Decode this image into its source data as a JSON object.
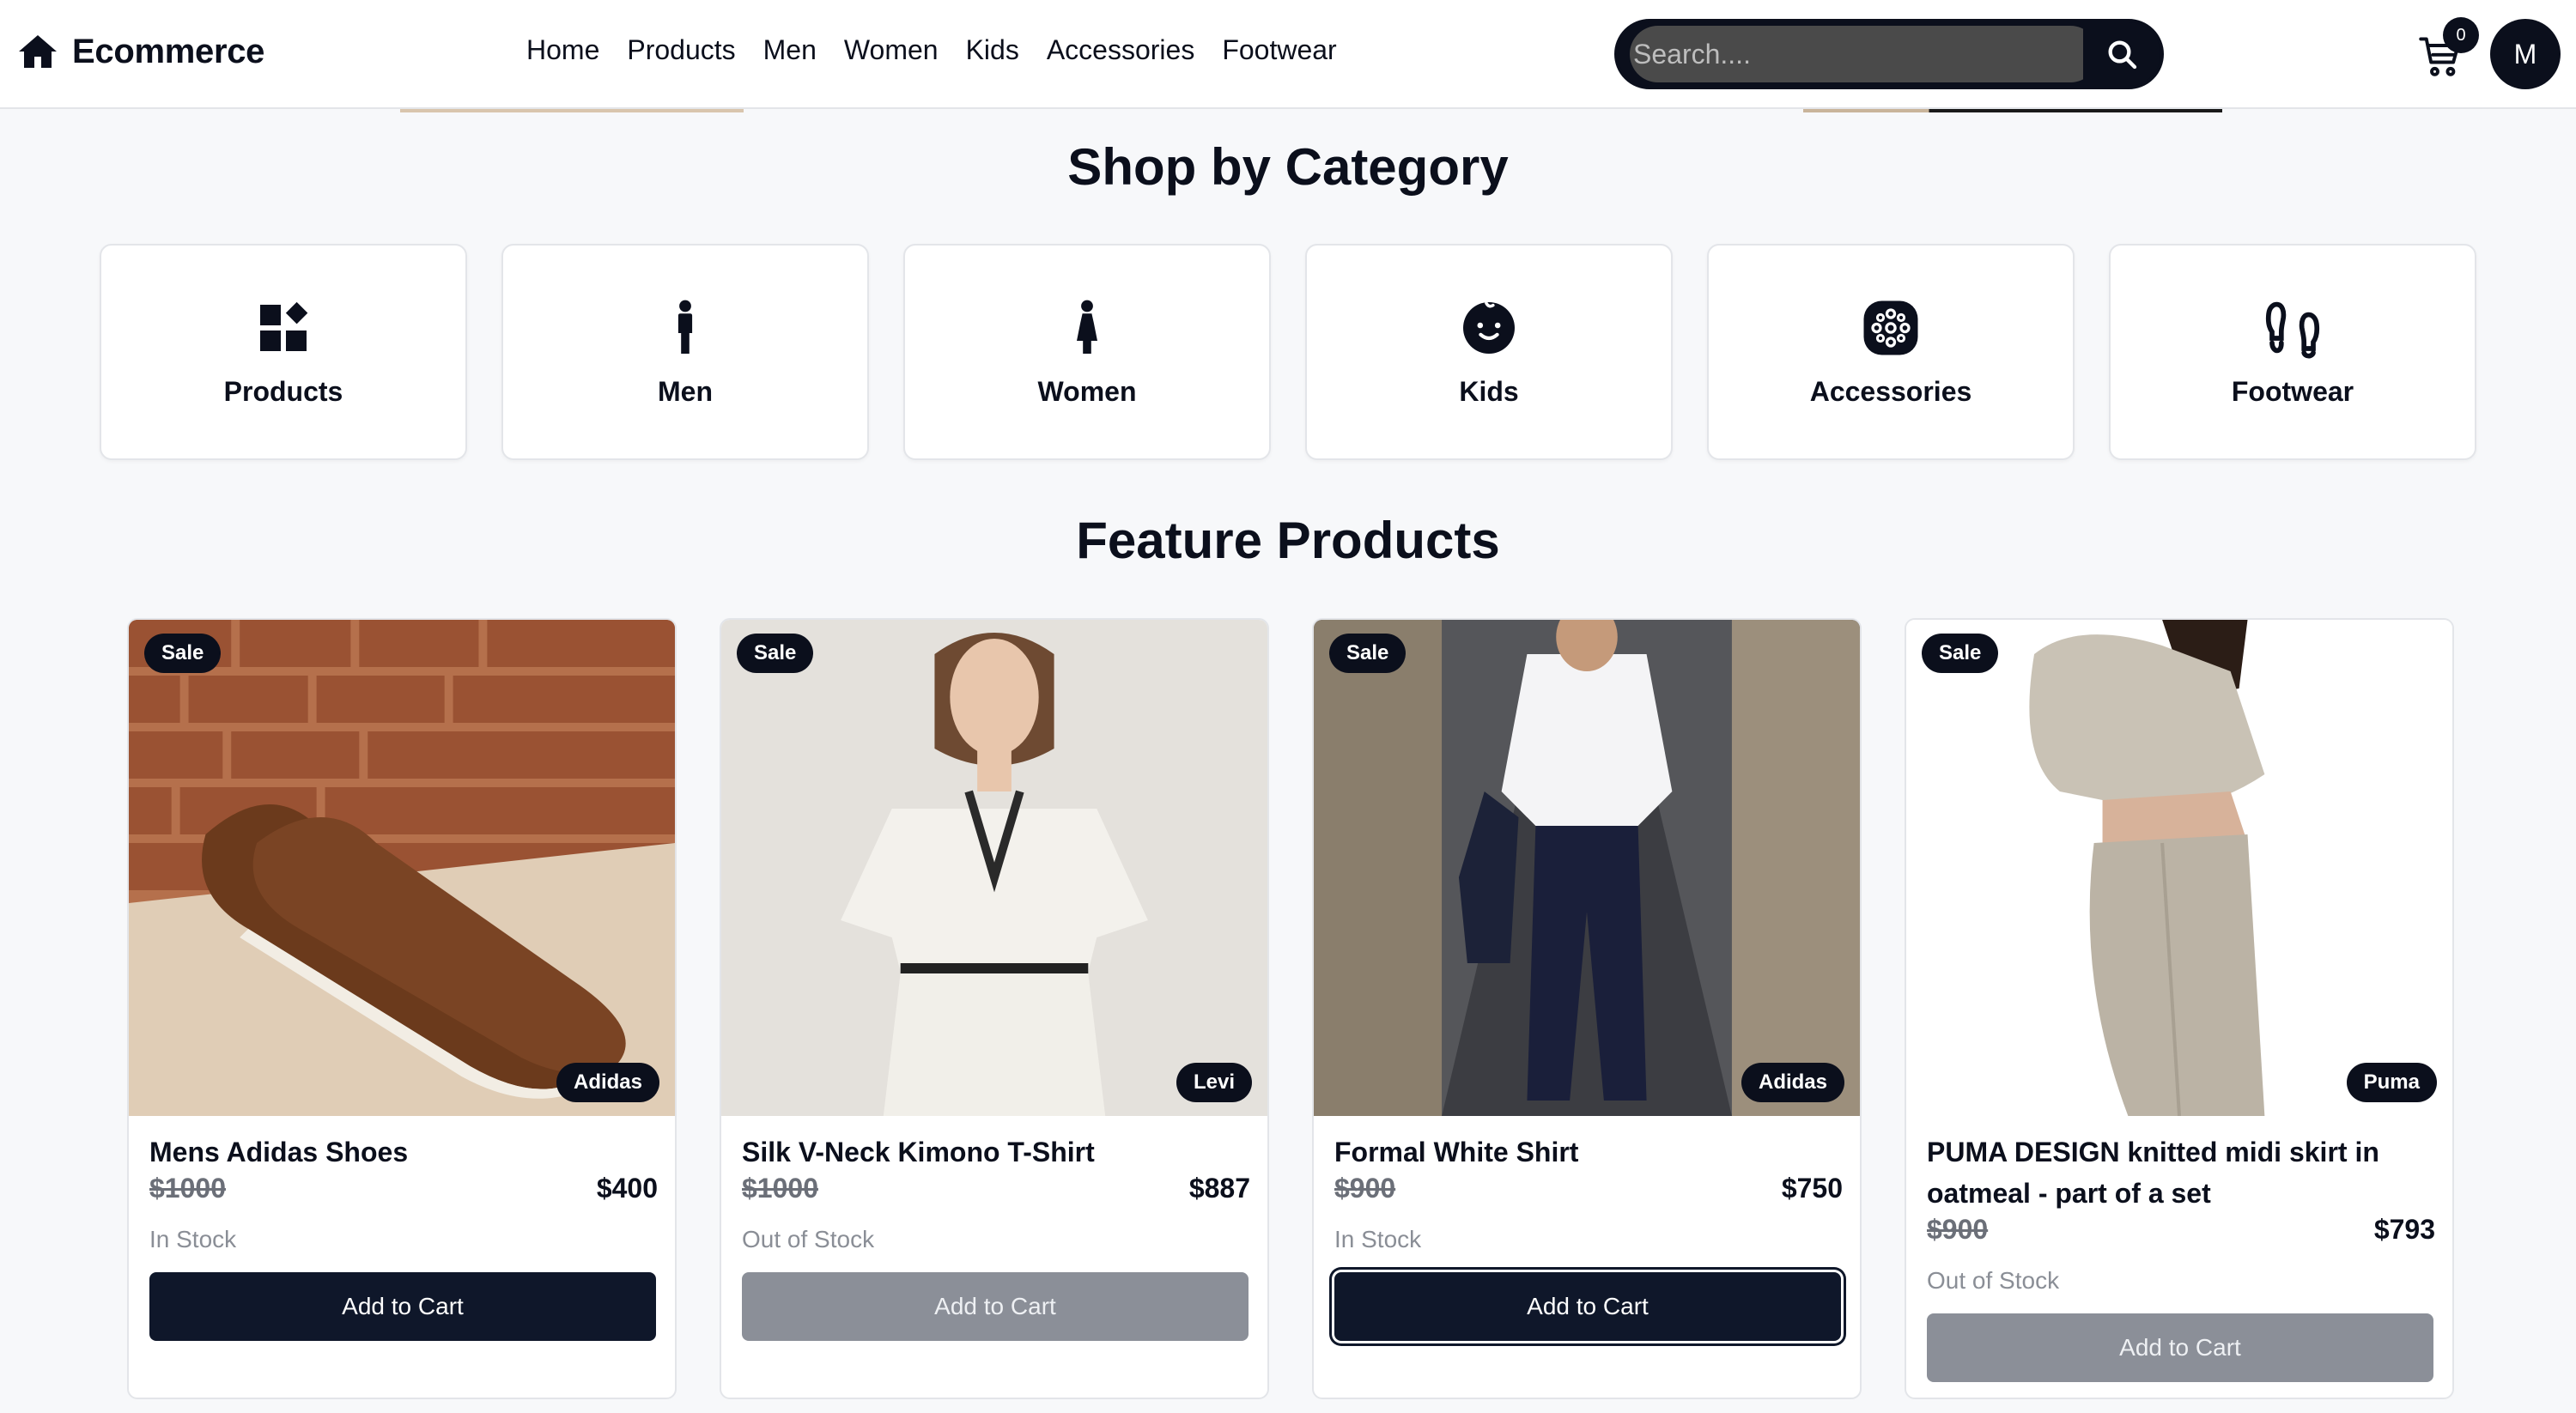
{
  "navbar": {
    "brand": "Ecommerce",
    "links": [
      "Home",
      "Products",
      "Men",
      "Women",
      "Kids",
      "Accessories",
      "Footwear"
    ],
    "search_placeholder": "Search....",
    "cart_count": "0",
    "avatar_initial": "M"
  },
  "categories_section": {
    "title": "Shop by Category",
    "items": [
      {
        "label": "Products",
        "icon": "grid-icon"
      },
      {
        "label": "Men",
        "icon": "man-icon"
      },
      {
        "label": "Women",
        "icon": "woman-icon"
      },
      {
        "label": "Kids",
        "icon": "baby-icon"
      },
      {
        "label": "Accessories",
        "icon": "accessory-icon"
      },
      {
        "label": "Footwear",
        "icon": "footprints-icon"
      }
    ]
  },
  "products_section": {
    "title": "Feature Products",
    "products": [
      {
        "name": "Mens Adidas Shoes",
        "old_price": "$1000",
        "price": "$400",
        "stock": "In Stock",
        "brand": "Adidas",
        "badge": "Sale",
        "button": "Add to Cart",
        "available": true
      },
      {
        "name": "Silk V-Neck Kimono T-Shirt",
        "old_price": "$1000",
        "price": "$887",
        "stock": "Out of Stock",
        "brand": "Levi",
        "badge": "Sale",
        "button": "Add to Cart",
        "available": false
      },
      {
        "name": "Formal White Shirt",
        "old_price": "$900",
        "price": "$750",
        "stock": "In Stock",
        "brand": "Adidas",
        "badge": "Sale",
        "button": "Add to Cart",
        "available": true
      },
      {
        "name": "PUMA DESIGN knitted midi skirt in oatmeal - part of a set",
        "old_price": "$900",
        "price": "$793",
        "stock": "Out of Stock",
        "brand": "Puma",
        "badge": "Sale",
        "button": "Add to Cart",
        "available": false
      }
    ]
  },
  "colors": {
    "primary": "#0f172a",
    "disabled": "#8b8f98",
    "background": "#f7f8fa"
  }
}
